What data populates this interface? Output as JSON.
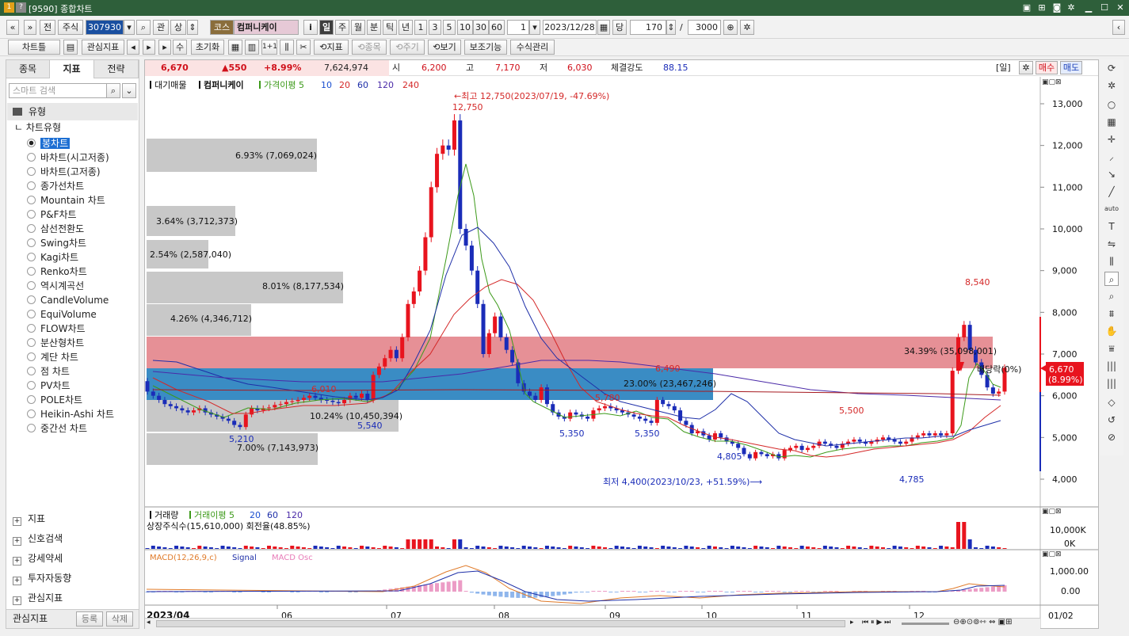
{
  "window": {
    "badge_1": "1",
    "badge_2": "?",
    "title": "[9590] 종합차트"
  },
  "toolbar1": {
    "prev": "«",
    "up": "»",
    "jeon": "전",
    "market": "주식",
    "code": "307930",
    "code_search": "⌕",
    "gwan": "관",
    "sang": "상",
    "tag": "코스",
    "name": "컴퍼니케이",
    "info": "i",
    "periods": [
      "일",
      "주",
      "월",
      "분",
      "틱",
      "년"
    ],
    "nums": [
      "1",
      "3",
      "5",
      "10",
      "30",
      "60"
    ],
    "count": "1",
    "date": "2023/12/28",
    "dang": "당",
    "bars": "170",
    "slash": "/",
    "total": "3000"
  },
  "toolbar2": {
    "chart_type": "차트틀",
    "interest_index": "관심지표",
    "su": "수",
    "reset": "초기화",
    "one_one": "1+1",
    "indicator": "지표",
    "item": "종목",
    "cycle": "주기",
    "view": "보기",
    "aux": "보조기능",
    "formula": "수식관리"
  },
  "sidebar": {
    "tabs": [
      "종목",
      "지표",
      "전략"
    ],
    "search_placeholder": "스마트 검색",
    "section_type": "유형",
    "chart_type": "차트유형",
    "items": [
      "봉차트",
      "바차트(시고저종)",
      "바차트(고저종)",
      "종가선차트",
      "Mountain 차트",
      "P&F차트",
      "삼선전환도",
      "Swing차트",
      "Kagi차트",
      "Renko차트",
      "역시계곡선",
      "CandleVolume",
      "EquiVolume",
      "FLOW차트",
      "분산형차트",
      "계단 차트",
      "점 차트",
      "PV차트",
      "POLE차트",
      "Heikin-Ashi 차트",
      "중간선 차트"
    ],
    "bottom_sections": [
      "지표",
      "신호검색",
      "강세약세",
      "투자자동향",
      "관심지표"
    ],
    "footer_label": "관심지표",
    "register": "등록",
    "delete": "삭제"
  },
  "infobar": {
    "price": "6,670",
    "change": "▲550",
    "rate": "+8.99%",
    "volume": "7,624,974",
    "open_label": "시",
    "open": "6,200",
    "high_label": "고",
    "high": "7,170",
    "low_label": "저",
    "low": "6,030",
    "strength_label": "체결강도",
    "strength": "88.15",
    "period": "[일]",
    "buy": "매수",
    "sell": "매도"
  },
  "legend": {
    "main": "대기매물",
    "name": "컴퍼니케이",
    "ma_label": "가격이평 5",
    "ma": [
      "10",
      "20",
      "60",
      "120",
      "240"
    ],
    "vol_title": "거래량",
    "vol_ma": "거래이평 5",
    "vol_ma_list": [
      "20",
      "60",
      "120"
    ],
    "shares": "상장주식수(15,610,000) 회전율(48.85%)",
    "macd": "MACD(12,26,9,c)",
    "signal": "Signal",
    "osc": "MACD Osc"
  },
  "annotations": {
    "high": "←최고 12,750(2023/07/19, -47.69%)",
    "high_val": "12,750",
    "low": "최저 4,400(2023/10/23, +51.59%)⟶",
    "labels": [
      "6,010",
      "5,210",
      "5,540",
      "5,350",
      "5,780",
      "5,350",
      "6,490",
      "4,805",
      "5,500",
      "4,785",
      "8,540"
    ],
    "profile": [
      "6.93% (7,069,024)",
      "3.64% (3,712,373)",
      "2.54% (2,587,040)",
      "8.01% (8,177,534)",
      "4.26% (4,346,712)",
      "23.00% (23,467,246)",
      "10.24% (10,450,394)",
      "7.00% (7,143,973)",
      "34.39% (35,098,001)"
    ],
    "dividend": "배당락(0%)",
    "cur_price": "6,670",
    "cur_rate": "(8.99%)"
  },
  "axes": {
    "price_ticks": [
      "13,000",
      "12,000",
      "11,000",
      "10,000",
      "9,000",
      "8,000",
      "7,000",
      "6,000",
      "5,000",
      "4,000"
    ],
    "vol_ticks": [
      "10,000K",
      "0K"
    ],
    "macd_ticks": [
      "1,000.00",
      "0.00"
    ],
    "x_labels": [
      "2023/04",
      "06",
      "07",
      "08",
      "09",
      "10",
      "11",
      "12",
      "01/02"
    ]
  },
  "colors": {
    "up": "#e8141e",
    "down": "#1a2cb8",
    "ma5": "#3d9a1a",
    "ma20": "#d42828",
    "ma60": "#1e2fa8",
    "profile_grey": "#c8c8c8",
    "band_pink": "#e69096",
    "band_blue": "#3a8cc4"
  },
  "chart_data": {
    "type": "candlestick",
    "title": "컴퍼니케이",
    "price_range": [
      4000,
      13000
    ],
    "highs": [
      {
        "date": "2023/07/19",
        "value": 12750
      }
    ],
    "lows": [
      {
        "date": "2023/10/23",
        "value": 4400
      }
    ],
    "current": 6670
  }
}
